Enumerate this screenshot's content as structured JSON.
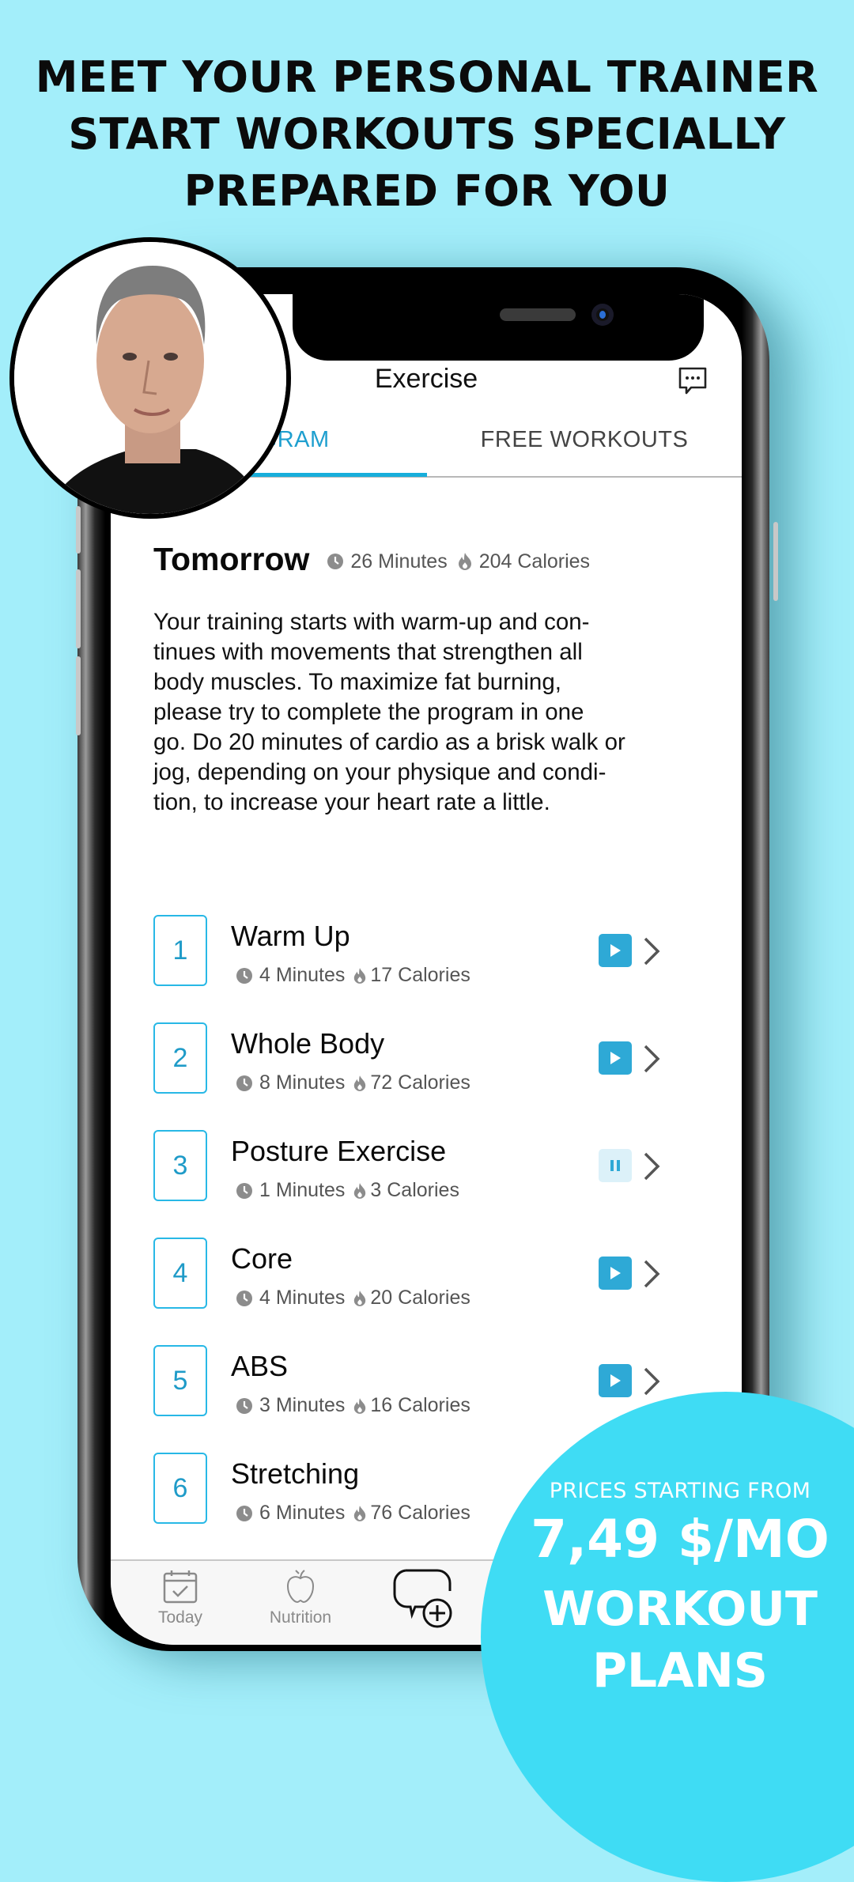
{
  "headline": {
    "lines": [
      "MEET YOUR PERSONAL TRAINER",
      "START WORKOUTS SPECIALLY",
      "PREPARED FOR YOU"
    ]
  },
  "app": {
    "title": "Exercise",
    "header_icon": "chat-bubble-icon",
    "tabs": [
      {
        "label": "PROGRAM",
        "visible_label": "OGRAM",
        "active": true
      },
      {
        "label": "FREE WORKOUTS",
        "active": false
      }
    ],
    "day": {
      "title": "Tomorrow",
      "minutes": "26 Minutes",
      "calories": "204 Calories"
    },
    "description_lines": [
      "Your training starts with warm-up and con-",
      "tinues with movements that strengthen all",
      "body muscles. To maximize fat burning,",
      "please try to complete the program in one",
      "go. Do 20 minutes of cardio as a brisk walk or",
      "jog, depending on your physique and condi-",
      "tion, to increase your heart rate a little."
    ],
    "exercises": [
      {
        "number": "1",
        "name": "Warm Up",
        "minutes": "4 Minutes",
        "calories": "17 Calories",
        "state": "play"
      },
      {
        "number": "2",
        "name": "Whole Body",
        "minutes": "8 Minutes",
        "calories": "72 Calories",
        "state": "play"
      },
      {
        "number": "3",
        "name": "Posture Exercise",
        "minutes": "1 Minutes",
        "calories": "3 Calories",
        "state": "paused"
      },
      {
        "number": "4",
        "name": "Core",
        "minutes": "4 Minutes",
        "calories": "20 Calories",
        "state": "play"
      },
      {
        "number": "5",
        "name": "ABS",
        "minutes": "3 Minutes",
        "calories": "16 Calories",
        "state": "play"
      },
      {
        "number": "6",
        "name": "Stretching",
        "minutes": "6 Minutes",
        "calories": "76 Calories",
        "state": "play"
      }
    ],
    "tabbar": [
      {
        "label": "Today",
        "icon": "calendar-check-icon"
      },
      {
        "label": "Nutrition",
        "icon": "apple-icon"
      },
      {
        "label": "",
        "icon": "chat-add-icon"
      }
    ]
  },
  "promo": {
    "line1": "PRICES STARTING FROM",
    "price": "7,49 $/MO",
    "line3": "WORKOUT",
    "line4": "PLANS"
  },
  "colors": {
    "background": "#a3eefa",
    "accent": "#1e9fcf",
    "tab_indicator": "#18aedb",
    "play_button": "#2ea9d6",
    "promo_circle": "#3fdcf4"
  }
}
